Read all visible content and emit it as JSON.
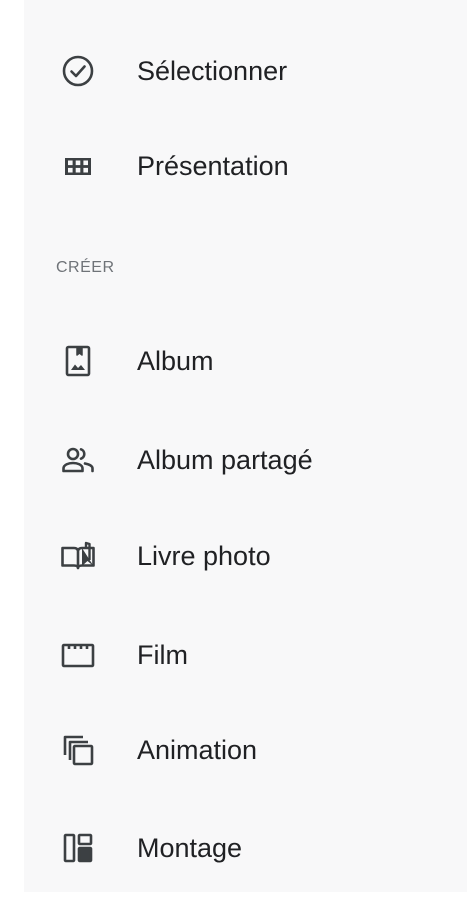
{
  "menu": {
    "top_items": [
      {
        "label": "Sélectionner",
        "icon": "check-circle-icon"
      },
      {
        "label": "Présentation",
        "icon": "grid-view-icon"
      }
    ],
    "create_section": {
      "header": "CRÉER",
      "items": [
        {
          "label": "Album",
          "icon": "album-icon"
        },
        {
          "label": "Album partagé",
          "icon": "shared-album-icon"
        },
        {
          "label": "Livre photo",
          "icon": "photo-book-icon"
        },
        {
          "label": "Film",
          "icon": "movie-icon"
        },
        {
          "label": "Animation",
          "icon": "animation-icon"
        },
        {
          "label": "Montage",
          "icon": "collage-icon"
        }
      ]
    }
  },
  "colors": {
    "background": "#f8f8f9",
    "text": "#202124",
    "section_header": "#6f7378",
    "icon": "#3c4043"
  }
}
